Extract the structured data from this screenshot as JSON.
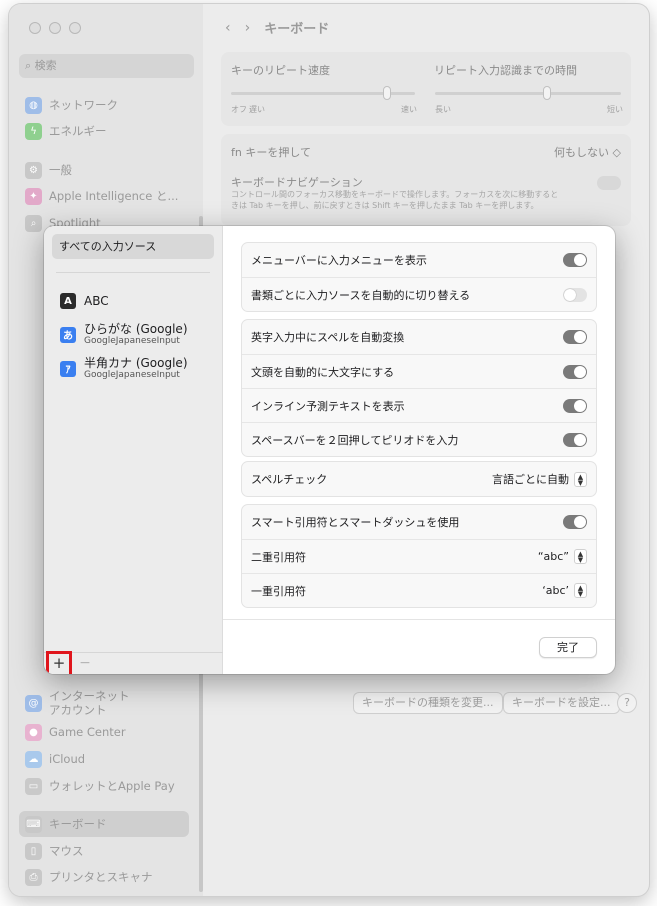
{
  "window": {
    "title": "キーボード"
  },
  "search": {
    "placeholder": "検索"
  },
  "sidebar": {
    "items": [
      {
        "label": "ネットワーク",
        "icon": "globe-icon",
        "color": "#9fbde8"
      },
      {
        "label": "エネルギー",
        "icon": "bolt-icon",
        "color": "#8fd08f"
      },
      {
        "label": "一般",
        "icon": "gear-icon",
        "color": "#c8c8c8"
      },
      {
        "label": "Apple Intelligence と...",
        "icon": "sparkle-icon",
        "color": "#e2a9c9"
      },
      {
        "label": "Spotlight",
        "icon": "magnifier-icon",
        "color": "#c8c8c8"
      },
      {
        "label": "インターネット\nアカウント",
        "icon": "at-icon",
        "color": "#9fbde8"
      },
      {
        "label": "Game Center",
        "icon": "game-center-icon",
        "color": "#e8b3d0"
      },
      {
        "label": "iCloud",
        "icon": "cloud-icon",
        "color": "#a9c9ec"
      },
      {
        "label": "ウォレットとApple Pay",
        "icon": "wallet-icon",
        "color": "#c9c9c9"
      },
      {
        "label": "キーボード",
        "icon": "keyboard-icon",
        "color": "#c8c8c8"
      },
      {
        "label": "マウス",
        "icon": "mouse-icon",
        "color": "#c8c8c8"
      },
      {
        "label": "プリンタとスキャナ",
        "icon": "printer-icon",
        "color": "#c8c8c8"
      }
    ]
  },
  "background": {
    "repeat_rate": "キーのリピート速度",
    "delay_until_repeat": "リピート入力認識までの時間",
    "off": "オフ",
    "slow": "遅い",
    "fast": "速い",
    "long": "長い",
    "short": "短い",
    "fn_label": "fn キーを押して",
    "fn_value": "何もしない",
    "nav_title": "キーボードナビゲーション",
    "nav_desc": "コントロール間のフォーカス移動をキーボードで操作します。フォーカスを次に移動するときは Tab キーを押し、前に戻すときは Shift キーを押したまま Tab キーを押します。",
    "change_type_btn": "キーボードの種類を変更...",
    "setup_btn": "キーボードを設定...",
    "help": "?"
  },
  "sheet": {
    "all_sources": "すべての入力ソース",
    "sources": [
      {
        "badge": "A",
        "name": "ABC",
        "sub": "",
        "color": "#2b2b2b"
      },
      {
        "badge": "あ",
        "name": "ひらがな (Google)",
        "sub": "GoogleJapaneseInput",
        "color": "#3a7ff0"
      },
      {
        "badge": "ｱ",
        "name": "半角カナ (Google)",
        "sub": "GoogleJapaneseInput",
        "color": "#3a7ff0"
      }
    ],
    "plus": "+",
    "minus": "−",
    "group1": [
      {
        "label": "メニューバーに入力メニューを表示",
        "on": true
      },
      {
        "label": "書類ごとに入力ソースを自動的に切り替える",
        "on": false
      }
    ],
    "group2": [
      {
        "label": "英字入力中にスペルを自動変換",
        "on": true
      },
      {
        "label": "文頭を自動的に大文字にする",
        "on": true
      },
      {
        "label": "インライン予測テキストを表示",
        "on": true
      },
      {
        "label": "スペースバーを２回押してピリオドを入力",
        "on": true
      }
    ],
    "spellcheck": {
      "label": "スペルチェック",
      "value": "言語ごとに自動"
    },
    "smart_quotes": {
      "label": "スマート引用符とスマートダッシュを使用",
      "on": true
    },
    "double_quote": {
      "label": "二重引用符",
      "value": "“abc”"
    },
    "single_quote": {
      "label": "一重引用符",
      "value": "‘abc’"
    },
    "done": "完了"
  }
}
